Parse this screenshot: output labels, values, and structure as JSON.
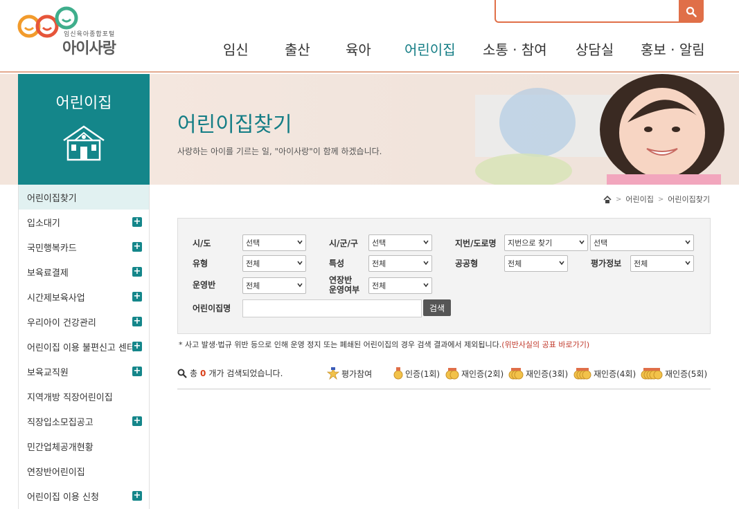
{
  "logo": {
    "sub": "임신육아종합포털",
    "main": "아이사랑"
  },
  "search": {
    "placeholder": "",
    "value": ""
  },
  "gnb": [
    "임신",
    "출산",
    "육아",
    "어린이집",
    "소통 · 참여",
    "상담실",
    "홍보 · 알림"
  ],
  "gnb_active": "어린이집",
  "sidebar": {
    "title": "어린이집",
    "items": [
      {
        "label": "어린이집찾기",
        "expand": false,
        "active": true
      },
      {
        "label": "입소대기",
        "expand": true
      },
      {
        "label": "국민행복카드",
        "expand": true
      },
      {
        "label": "보육료결제",
        "expand": true
      },
      {
        "label": "시간제보육사업",
        "expand": true
      },
      {
        "label": "우리아이 건강관리",
        "expand": true
      },
      {
        "label": "어린이집 이용 불편신고 센터",
        "expand": true
      },
      {
        "label": "보육교직원",
        "expand": true
      },
      {
        "label": "지역개방 직장어린이집",
        "expand": false
      },
      {
        "label": "직장입소모집공고",
        "expand": true
      },
      {
        "label": "민간업체공개현황",
        "expand": false
      },
      {
        "label": "연장반어린이집",
        "expand": false
      },
      {
        "label": "어린이집 이용 신청",
        "expand": true
      }
    ]
  },
  "visual": {
    "title": "어린이집찾기",
    "desc": "사랑하는 아이를 기르는 일, \"아이사랑\"이 함께 하겠습니다."
  },
  "breadcrumb": [
    "어린이집",
    "어린이집찾기"
  ],
  "form": {
    "sido_label": "시/도",
    "sido_value": "선택",
    "sigungu_label": "시/군/구",
    "sigungu_value": "선택",
    "address_label": "지번/도로명",
    "address_type_value": "지번으로 찾기",
    "address_value": "선택",
    "type_label": "유형",
    "type_value": "전체",
    "feature_label": "특성",
    "feature_value": "전체",
    "public_label": "공공형",
    "public_value": "전체",
    "eval_label": "평가정보",
    "eval_value": "전체",
    "class_label": "운영반",
    "class_value": "전체",
    "extended_label_1": "연장반",
    "extended_label_2": "운영여부",
    "extended_value": "전체",
    "name_label": "어린이집명",
    "name_value": "",
    "search_button": "검색"
  },
  "notice": {
    "text": "* 사고 발생·법규 위반 등으로 인해 운영 정지 또는 폐쇄된 어린이집의 경우 검색 결과에서 제외됩니다.",
    "link": "(위반사실의 공표 바로가기)"
  },
  "result": {
    "prefix": "총",
    "count": "0",
    "suffix": "개가 검색되었습니다."
  },
  "legend": {
    "eval": "평가참여",
    "cert1": "인증(1회)",
    "cert2": "재인증(2회)",
    "cert3": "재인증(3회)",
    "cert4": "재인증(4회)",
    "cert5": "재인증(5회)"
  },
  "colors": {
    "accent": "#147d85",
    "brand_orange": "#e06f48",
    "count_red": "#d9401a",
    "notice_red": "#c0392b"
  }
}
